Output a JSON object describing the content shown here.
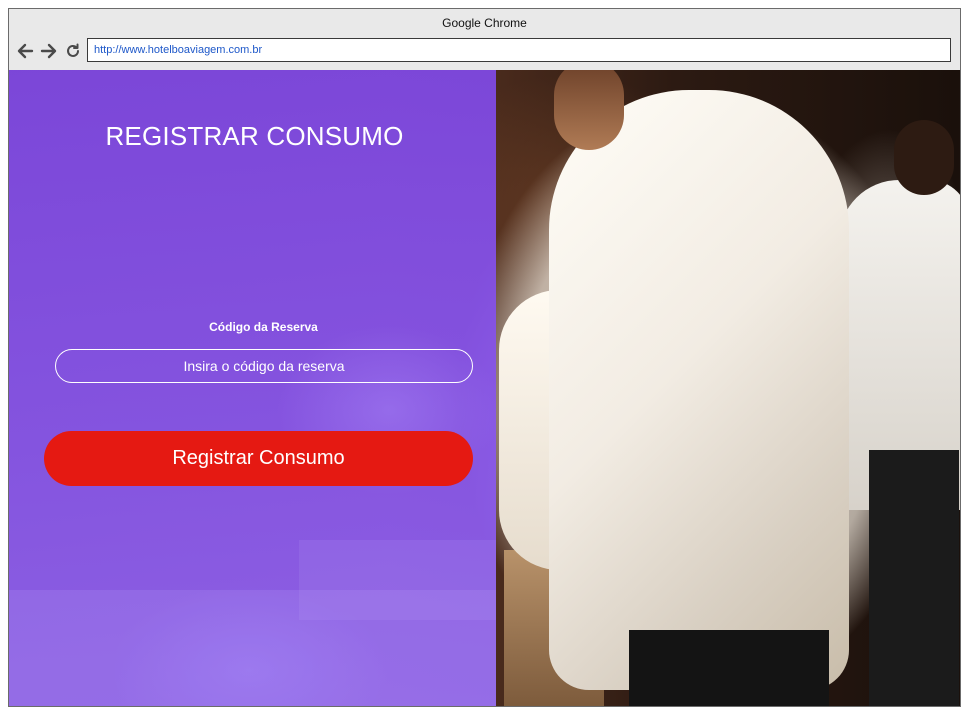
{
  "browser": {
    "title": "Google Chrome",
    "url": "http://www.hotelboaviagem.com.br",
    "icons": [
      "arrow-left-icon",
      "arrow-right-icon",
      "reload-icon"
    ]
  },
  "page": {
    "heading": "REGISTRAR CONSUMO",
    "form": {
      "label": "Código da Reserva",
      "input_value": "",
      "input_placeholder": "Insira o código da reserva",
      "submit_label": "Registrar Consumo"
    }
  },
  "colors": {
    "panel_purple": "#8050e0",
    "button_red": "#e51912",
    "url_text": "#1e58c9"
  }
}
